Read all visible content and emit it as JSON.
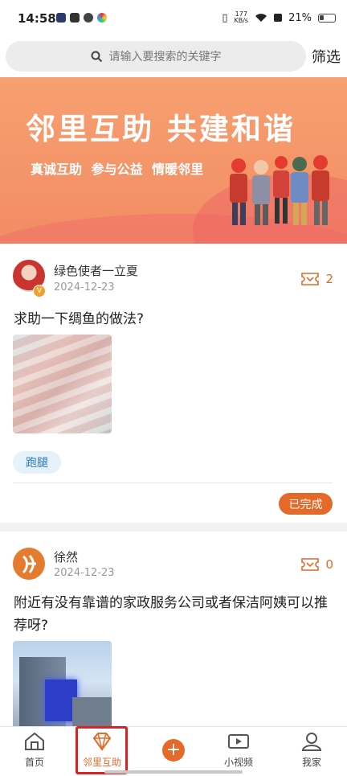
{
  "status_bar": {
    "time": "14:58",
    "net_speed_value": "177",
    "net_speed_unit": "KB/s",
    "battery": "21%"
  },
  "search": {
    "placeholder": "请输入要搜索的关键字",
    "filter_label": "筛选"
  },
  "banner": {
    "title": "邻里互助 共建和谐",
    "subtitle": "真诚互助  参与公益  情暖邻里"
  },
  "posts": [
    {
      "user": "绿色使者一立夏",
      "date": "2024-12-23",
      "reward": "2",
      "title": "求助一下绸鱼的做法?",
      "tag": "跑腿",
      "status": "已完成"
    },
    {
      "user": "徐然",
      "date": "2024-12-23",
      "reward": "0",
      "title": "附近有没有靠谱的家政服务公司或者保洁阿姨可以推荐呀?"
    }
  ],
  "nav": {
    "home": "首页",
    "help": "邻里互助",
    "video": "小视频",
    "me": "我家"
  },
  "colors": {
    "accent": "#e56a2a",
    "tag_text": "#2a79c2",
    "highlight": "#d62424"
  }
}
